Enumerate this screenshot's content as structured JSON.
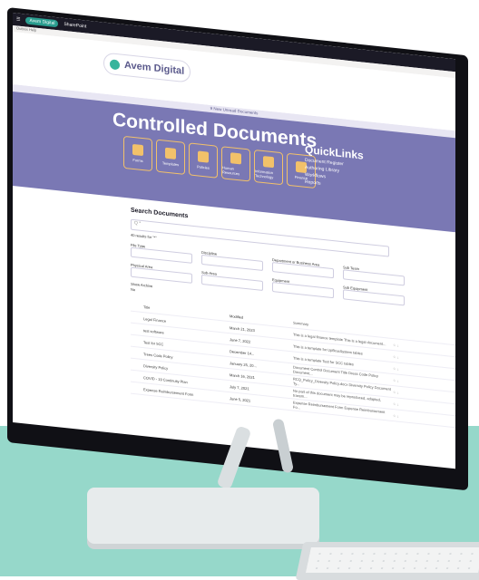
{
  "topbar": {
    "brand": "Avem Digital",
    "app": "SharePoint"
  },
  "subbar": {
    "text": "Outbox   Help"
  },
  "logo": {
    "name": "Avem Digital"
  },
  "alert": {
    "text": "9 New Unread Documents"
  },
  "banner": {
    "title": "Controlled Documents",
    "tiles": [
      {
        "label": "Forms",
        "icon": "link-icon"
      },
      {
        "label": "Templates",
        "icon": "files-icon"
      },
      {
        "label": "Policies",
        "icon": "folder-icon"
      },
      {
        "label": "Human Resources",
        "icon": "person-icon"
      },
      {
        "label": "Information Technology",
        "icon": "monitor-icon"
      },
      {
        "label": "Finance",
        "icon": "dollar-icon"
      }
    ],
    "quicklinks": {
      "heading": "QuickLinks",
      "items": [
        "Document Register",
        "Authoring Library",
        "Workflows",
        "Reports"
      ]
    }
  },
  "search": {
    "title": "Search Documents",
    "results": "40 results for \"*\"",
    "placeholder": "Q *",
    "filters": [
      {
        "label": "File Type"
      },
      {
        "label": "Discipline"
      },
      {
        "label": "Department or Business Area"
      },
      {
        "label": "Sub Team"
      }
    ],
    "filters2": [
      {
        "label": "Physical Area"
      },
      {
        "label": "Sub-Area"
      },
      {
        "label": "Equipment"
      },
      {
        "label": "Sub Equipment"
      }
    ],
    "show_archive": "Show Archive",
    "toggle_label": "No"
  },
  "table": {
    "headers": [
      "Title",
      "Modified",
      "Summary"
    ],
    "rows": [
      {
        "title": "Legal Finance",
        "modified": "March 21, 2023",
        "summary": "This is a legal finance template This is a legal document..."
      },
      {
        "title": "test software",
        "modified": "June 7, 2022",
        "summary": "This is a template for UpBrasSystem tables"
      },
      {
        "title": "Test for 5CC",
        "modified": "December 14...",
        "summary": "This is a template Test for SCC tables"
      },
      {
        "title": "Trees Code Policy",
        "modified": "January 25, 20...",
        "summary": "Document Control Document Title Dress Code Policy Document..."
      },
      {
        "title": "Diversity Policy",
        "modified": "March 16, 2021",
        "summary": "RCQ_Policy_Diversity Policy.docx Diversity Policy Document Ty..."
      },
      {
        "title": "COVID - 19 Continuity Plan",
        "modified": "July 7, 2021",
        "summary": "No part of this document may be reproduced, adapted, transm..."
      },
      {
        "title": "Expense Reimbursement Form",
        "modified": "June 5, 2021",
        "summary": "Expense Reimbursement Form Expense Reimbursement Fo..."
      }
    ]
  },
  "colors": {
    "banner": "#7a78b4",
    "accent": "#f2c16a",
    "floor": "#96d8ca"
  }
}
